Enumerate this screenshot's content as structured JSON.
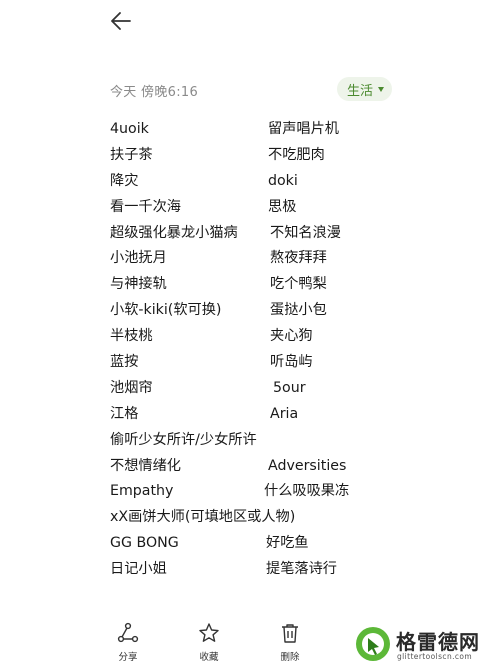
{
  "note": {
    "date": "今天 傍晚6:16",
    "category": "生活",
    "lines": [
      [
        "4uoik",
        "留声唱片机"
      ],
      [
        "扶子茶",
        "不吃肥肉"
      ],
      [
        "降灾",
        "doki"
      ],
      [
        "看一千次海",
        "思极"
      ],
      [
        "超级强化暴龙小猫病",
        "不知名浪漫"
      ],
      [
        "小池抚月",
        "熬夜拜拜"
      ],
      [
        "与神接轨",
        "吃个鸭梨"
      ],
      [
        "小软-kiki(软可换)",
        "蛋挞小包"
      ],
      [
        "半枝桃",
        "夹心狗"
      ],
      [
        "蓝按",
        "听岛屿"
      ],
      [
        "池烟帘",
        "5our"
      ],
      [
        "江格",
        "Aria"
      ],
      [
        "偷听少女所许/少女所许",
        ""
      ],
      [
        "不想情绪化",
        "Adversities"
      ],
      [
        "Empathy",
        "什么吸吸果冻"
      ],
      [
        "xX画饼大师(可填地区或人物)",
        ""
      ],
      [
        "GG BONG",
        "好吃鱼"
      ],
      [
        "日记小姐",
        "提笔落诗行"
      ]
    ]
  },
  "toolbar": {
    "share_label": "分享",
    "favorite_label": "收藏",
    "delete_label": "删除"
  },
  "watermark": {
    "name": "格雷德网",
    "url": "glittertoolscn.com"
  },
  "colors": {
    "accent_green": "#4b8a2f",
    "chip_bg": "#eef4ea",
    "meta_gray": "#8a8a8a"
  }
}
